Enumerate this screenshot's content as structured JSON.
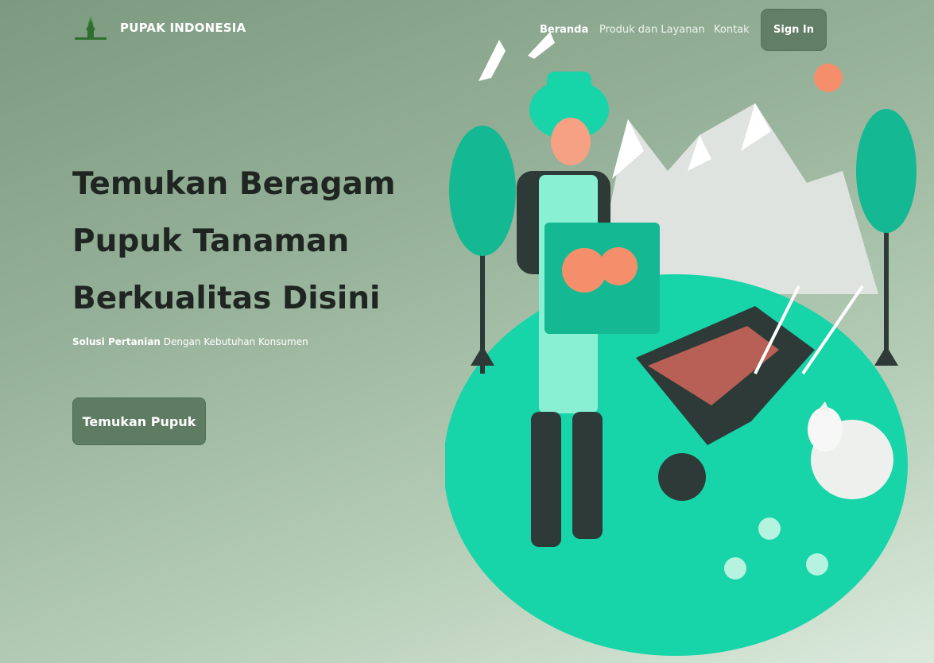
{
  "nav": {
    "brand": "PUPAK INDONESIA",
    "links": [
      "Beranda",
      "Produk dan Layanan",
      "Kontak"
    ],
    "signin": "Sign In"
  },
  "hero": {
    "title_lines": [
      "Temukan Beragam",
      "Pupuk Tanaman",
      "Berkualitas Disini"
    ],
    "subtitle_bold": "Solusi Pertanian",
    "subtitle_rest": " Dengan Kebutuhan Konsumen",
    "cta": "Temukan Pupuk"
  },
  "colors": {
    "accent": "#5e7c62",
    "ground": "#18d4a9",
    "text_dark": "#1f2520"
  },
  "icons": {
    "logo": "plant-logo-icon",
    "illustration": "farmer-wheelbarrow-illustration"
  }
}
